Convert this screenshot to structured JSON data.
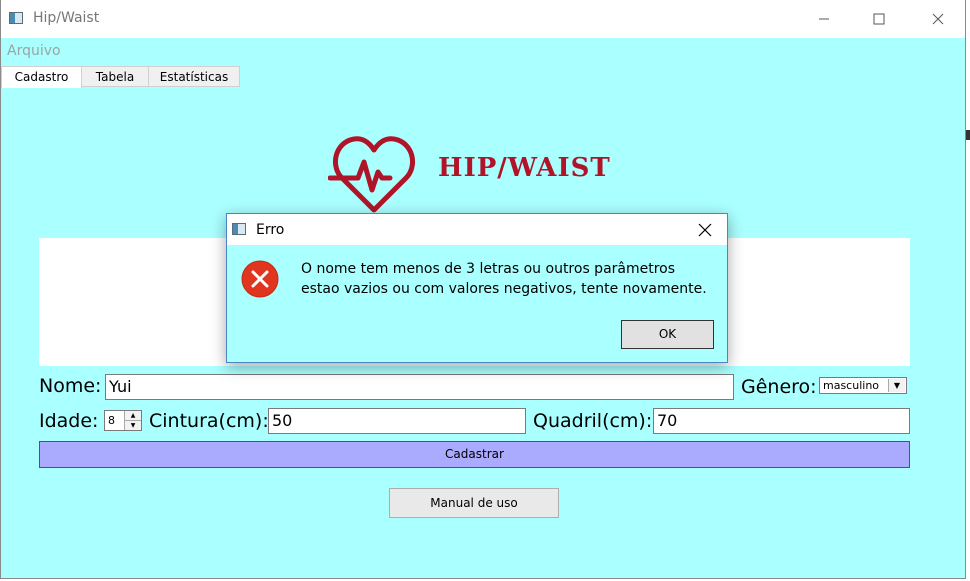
{
  "window": {
    "title": "Hip/Waist"
  },
  "menu": {
    "arquivo": "Arquivo"
  },
  "tabs": [
    {
      "label": "Cadastro",
      "active": true
    },
    {
      "label": "Tabela",
      "active": false
    },
    {
      "label": "Estatísticas",
      "active": false
    }
  ],
  "logo": {
    "text": "Hip/Waist",
    "icon": "heart-pulse-icon",
    "color": "#b01428"
  },
  "form": {
    "nome_label": "Nome:",
    "nome_value": "Yui",
    "genero_label": "Gênero:",
    "genero_value": "masculino",
    "idade_label": "Idade:",
    "idade_value": "8",
    "cintura_label": "Cintura(cm):",
    "cintura_value": "50",
    "quadril_label": "Quadril(cm):",
    "quadril_value": "70",
    "cadastrar_label": "Cadastrar",
    "manual_label": "Manual de uso"
  },
  "dialog": {
    "title": "Erro",
    "icon": "error-icon",
    "message": "O nome tem menos de 3 letras ou outros parâmetros estao vazios ou com valores negativos, tente novamente.",
    "ok_label": "OK"
  },
  "colors": {
    "background": "#aaffff",
    "cadastrar_button": "#aaaaff",
    "error_red": "#e0361f"
  }
}
